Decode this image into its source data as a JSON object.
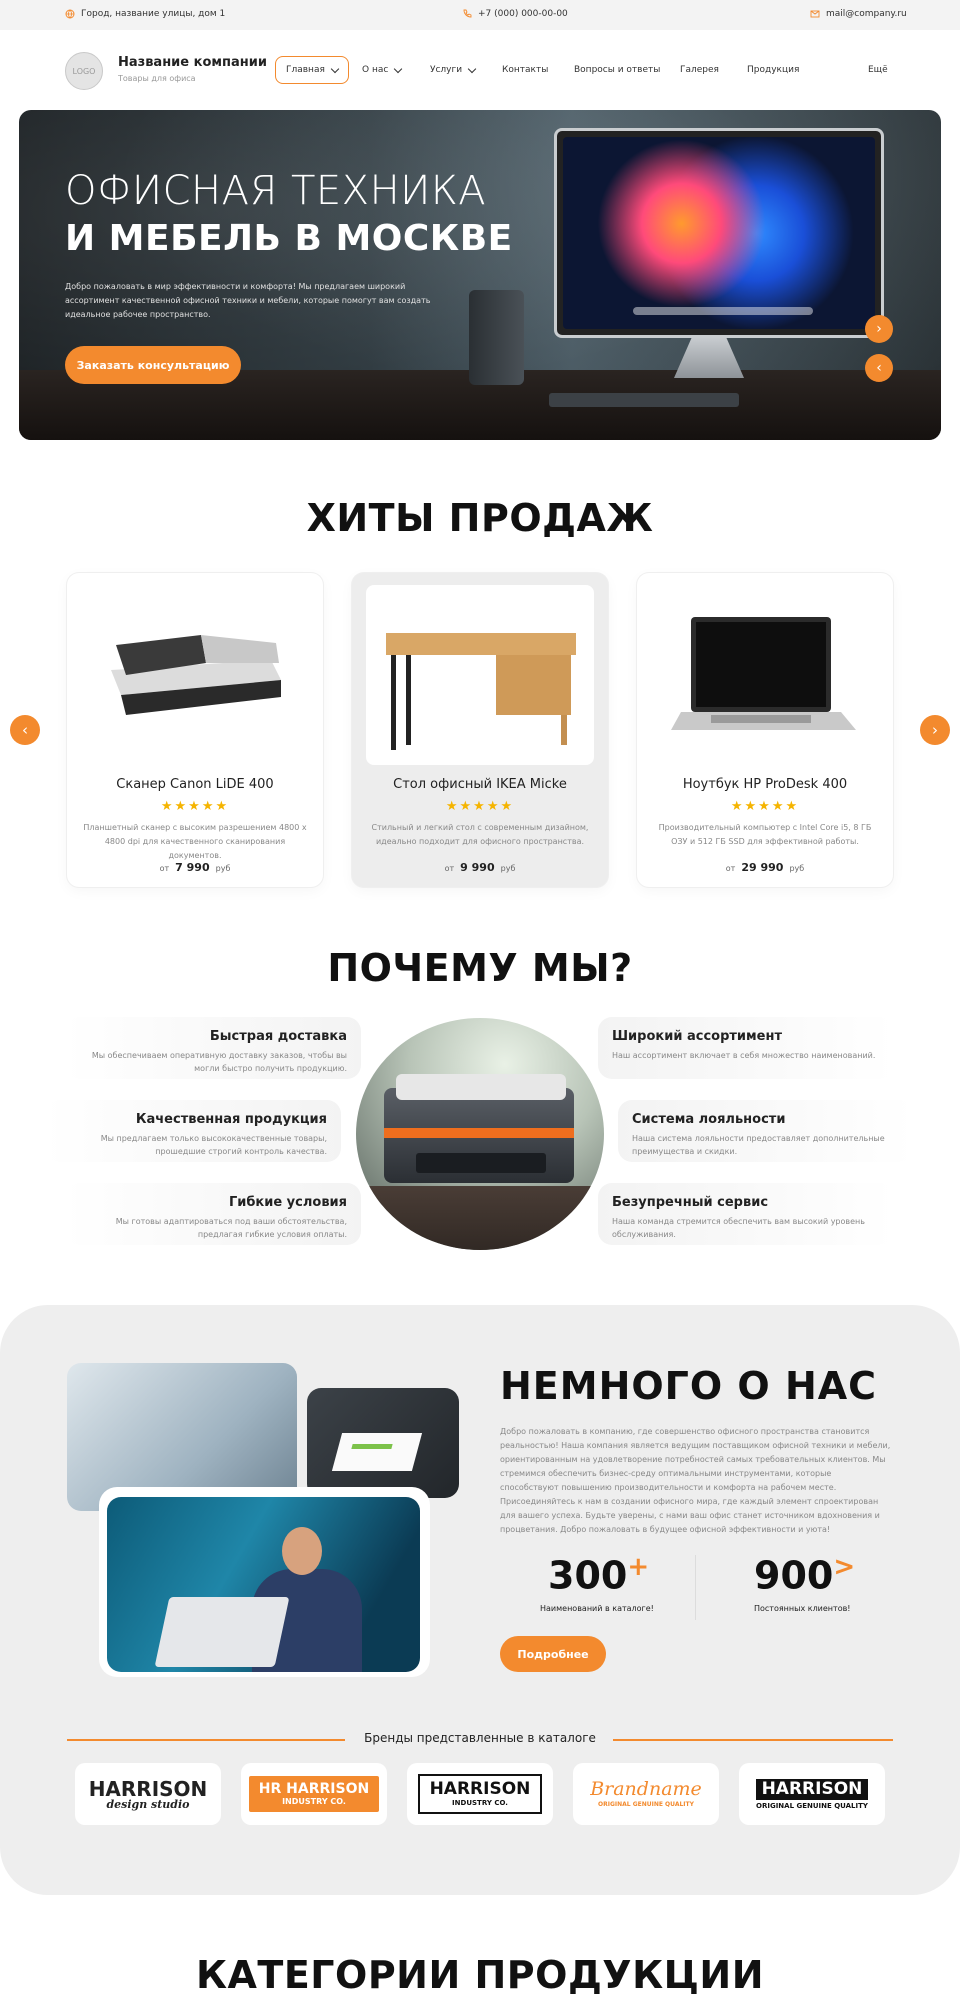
{
  "topbar": {
    "address": "Город, название улицы, дом 1",
    "phone": "+7 (000) 000-00-00",
    "email": "mail@company.ru"
  },
  "header": {
    "logo_text": "LOGO",
    "company_name": "Название компании",
    "company_sub": "Товары для офиса",
    "nav": {
      "home": "Главная",
      "about": "О нас",
      "services": "Услуги",
      "contacts": "Контакты",
      "faq": "Вопросы и ответы",
      "gallery": "Галерея",
      "products": "Продукция",
      "more": "Ещё"
    }
  },
  "hero": {
    "title_line1": "ОФИСНАЯ ТЕХНИКА",
    "title_line2": "И МЕБЕЛЬ В МОСКВЕ",
    "text": "Добро пожаловать в мир эффективности и комфорта! Мы предлагаем широкий ассортимент качественной офисной техники и мебели, которые помогут вам создать идеальное рабочее пространство.",
    "button": "Заказать консультацию"
  },
  "hits": {
    "title": "ХИТЫ ПРОДАЖ",
    "products": [
      {
        "name": "Сканер Canon LiDE 400",
        "stars": "★★★★★",
        "desc": "Планшетный сканер с высоким разрешением 4800 x 4800 dpi для качественного сканирования документов.",
        "price_prefix": "от",
        "price": "7 990",
        "currency": "руб"
      },
      {
        "name": "Стол офисный IKEA Micke",
        "stars": "★★★★★",
        "desc": "Стильный и легкий стол с современным дизайном, идеально подходит для офисного пространства.",
        "price_prefix": "от",
        "price": "9 990",
        "currency": "руб"
      },
      {
        "name": "Ноутбук HP ProDesk 400",
        "stars": "★★★★★",
        "desc": "Производительный компьютер с Intel Core i5, 8 ГБ ОЗУ и 512 ГБ SSD для эффективной работы.",
        "price_prefix": "от",
        "price": "29 990",
        "currency": "руб"
      }
    ]
  },
  "why": {
    "title": "ПОЧЕМУ МЫ?",
    "features": [
      {
        "title": "Быстрая доставка",
        "text": "Мы обеспечиваем оперативную доставку заказов, чтобы вы могли быстро получить продукцию."
      },
      {
        "title": "Качественная продукция",
        "text": "Мы предлагаем только высококачественные товары, прошедшие строгий контроль качества."
      },
      {
        "title": "Гибкие условия",
        "text": "Мы готовы адаптироваться под ваши обстоятельства, предлагая гибкие условия оплаты."
      },
      {
        "title": "Широкий ассортимент",
        "text": "Наш ассортимент включает в себя множество наименований."
      },
      {
        "title": "Система лояльности",
        "text": "Наша система лояльности предоставляет дополнительные преимущества и скидки."
      },
      {
        "title": "Безупречный сервис",
        "text": "Наша команда стремится обеспечить вам высокий уровень обслуживания."
      }
    ]
  },
  "about": {
    "title": "НЕМНОГО О НАС",
    "text": "Добро пожаловать в компанию, где совершенство офисного пространства становится реальностью! Наша компания является ведущим поставщиком офисной техники и мебели, ориентированным на удовлетворение потребностей самых требовательных клиентов. Мы стремимся обеспечить бизнес-среду оптимальными инструментами, которые способствуют повышению производительности и комфорта на рабочем месте. Присоединяйтесь к нам в создании офисного мира, где каждый элемент спроектирован для вашего успеха. Будьте уверены, с нами ваш офис станет источником вдохновения и процветания. Добро пожаловать в будущее офисной эффективности и уюта!",
    "stat1_value": "300",
    "stat1_suffix": "+",
    "stat1_label": "Наименований в каталоге!",
    "stat2_value": "900",
    "stat2_suffix": ">",
    "stat2_label": "Постоянных клиентов!",
    "button": "Подробнее",
    "brands_label": "Бренды представленные в каталоге",
    "brands": [
      {
        "line1": "HARRISON",
        "line2": "design studio"
      },
      {
        "line1": "HR HARRISON",
        "line2": "INDUSTRY CO."
      },
      {
        "line1": "HARRISON",
        "line2": "INDUSTRY CO."
      },
      {
        "line1": "Brandname",
        "line2": "ORIGINAL GENUINE QUALITY"
      },
      {
        "line1": "HARRISON",
        "line2": "ORIGINAL GENUINE QUALITY"
      }
    ]
  },
  "categories": {
    "title": "КАТЕГОРИИ ПРОДУКЦИИ"
  },
  "colors": {
    "accent": "#f38a2e",
    "star": "#f5b400",
    "section_bg": "#eeeeee"
  }
}
